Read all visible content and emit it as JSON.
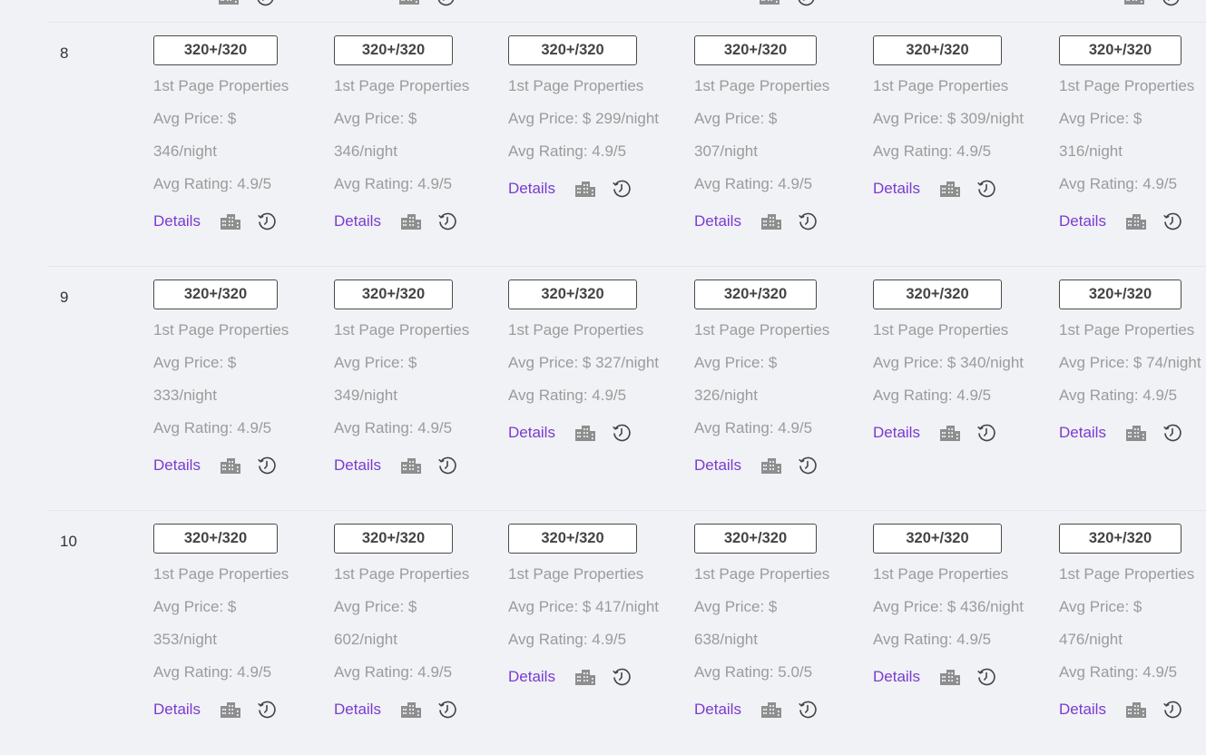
{
  "columns_x": [
    169,
    368,
    560,
    765,
    962,
    1167
  ],
  "badge_widths": [
    137,
    131,
    142,
    135,
    142,
    135
  ],
  "labels": {
    "badge": "320+/320",
    "properties": "1st Page Properties",
    "avg_price_prefix": "Avg Price: $",
    "avg_rating_prefix": "Avg Rating: ",
    "details": "Details"
  },
  "icons": [
    "building-icon",
    "clock-history-icon"
  ],
  "rows": [
    {
      "num": "8",
      "cells": [
        {
          "badge": "320+/320",
          "properties": "1st Page Properties",
          "price_lines": [
            "Avg Price: $",
            "346/night"
          ],
          "rating": "Avg Rating: 4.9/5",
          "details": "Details"
        },
        {
          "badge": "320+/320",
          "properties": "1st Page Properties",
          "price_lines": [
            "Avg Price: $",
            "346/night"
          ],
          "rating": "Avg Rating: 4.9/5",
          "details": "Details"
        },
        {
          "badge": "320+/320",
          "properties": "1st Page Properties",
          "price_lines": [
            "Avg Price: $ 299/night"
          ],
          "rating": "Avg Rating: 4.9/5",
          "details": "Details"
        },
        {
          "badge": "320+/320",
          "properties": "1st Page Properties",
          "price_lines": [
            "Avg Price: $",
            "307/night"
          ],
          "rating": "Avg Rating: 4.9/5",
          "details": "Details"
        },
        {
          "badge": "320+/320",
          "properties": "1st Page Properties",
          "price_lines": [
            "Avg Price: $ 309/night"
          ],
          "rating": "Avg Rating: 4.9/5",
          "details": "Details"
        },
        {
          "badge": "320+/320",
          "properties": "1st Page Properties",
          "price_lines": [
            "Avg Price: $",
            "316/night"
          ],
          "rating": "Avg Rating: 4.9/5",
          "details": "Details"
        }
      ]
    },
    {
      "num": "9",
      "cells": [
        {
          "badge": "320+/320",
          "properties": "1st Page Properties",
          "price_lines": [
            "Avg Price: $",
            "333/night"
          ],
          "rating": "Avg Rating: 4.9/5",
          "details": "Details"
        },
        {
          "badge": "320+/320",
          "properties": "1st Page Properties",
          "price_lines": [
            "Avg Price: $",
            "349/night"
          ],
          "rating": "Avg Rating: 4.9/5",
          "details": "Details"
        },
        {
          "badge": "320+/320",
          "properties": "1st Page Properties",
          "price_lines": [
            "Avg Price: $ 327/night"
          ],
          "rating": "Avg Rating: 4.9/5",
          "details": "Details"
        },
        {
          "badge": "320+/320",
          "properties": "1st Page Properties",
          "price_lines": [
            "Avg Price: $",
            "326/night"
          ],
          "rating": "Avg Rating: 4.9/5",
          "details": "Details"
        },
        {
          "badge": "320+/320",
          "properties": "1st Page Properties",
          "price_lines": [
            "Avg Price: $ 340/night"
          ],
          "rating": "Avg Rating: 4.9/5",
          "details": "Details"
        },
        {
          "badge": "320+/320",
          "properties": "1st Page Properties",
          "price_lines": [
            "Avg Price: $ 74/night"
          ],
          "rating": "Avg Rating: 4.9/5",
          "details": "Details"
        }
      ]
    },
    {
      "num": "10",
      "cells": [
        {
          "badge": "320+/320",
          "properties": "1st Page Properties",
          "price_lines": [
            "Avg Price: $",
            "353/night"
          ],
          "rating": "Avg Rating: 4.9/5",
          "details": "Details"
        },
        {
          "badge": "320+/320",
          "properties": "1st Page Properties",
          "price_lines": [
            "Avg Price: $",
            "602/night"
          ],
          "rating": "Avg Rating: 4.9/5",
          "details": "Details"
        },
        {
          "badge": "320+/320",
          "properties": "1st Page Properties",
          "price_lines": [
            "Avg Price: $ 417/night"
          ],
          "rating": "Avg Rating: 4.9/5",
          "details": "Details"
        },
        {
          "badge": "320+/320",
          "properties": "1st Page Properties",
          "price_lines": [
            "Avg Price: $",
            "638/night"
          ],
          "rating": "Avg Rating: 5.0/5",
          "details": "Details"
        },
        {
          "badge": "320+/320",
          "properties": "1st Page Properties",
          "price_lines": [
            "Avg Price: $ 436/night"
          ],
          "rating": "Avg Rating: 4.9/5",
          "details": "Details"
        },
        {
          "badge": "320+/320",
          "properties": "1st Page Properties",
          "price_lines": [
            "Avg Price: $",
            "476/night"
          ],
          "rating": "Avg Rating: 4.9/5",
          "details": "Details"
        }
      ]
    }
  ],
  "colors": {
    "background": "#f0f2f5",
    "muted_text": "#9b9b9b",
    "link": "#7b3bd0",
    "icon": "#8e8e8e"
  }
}
